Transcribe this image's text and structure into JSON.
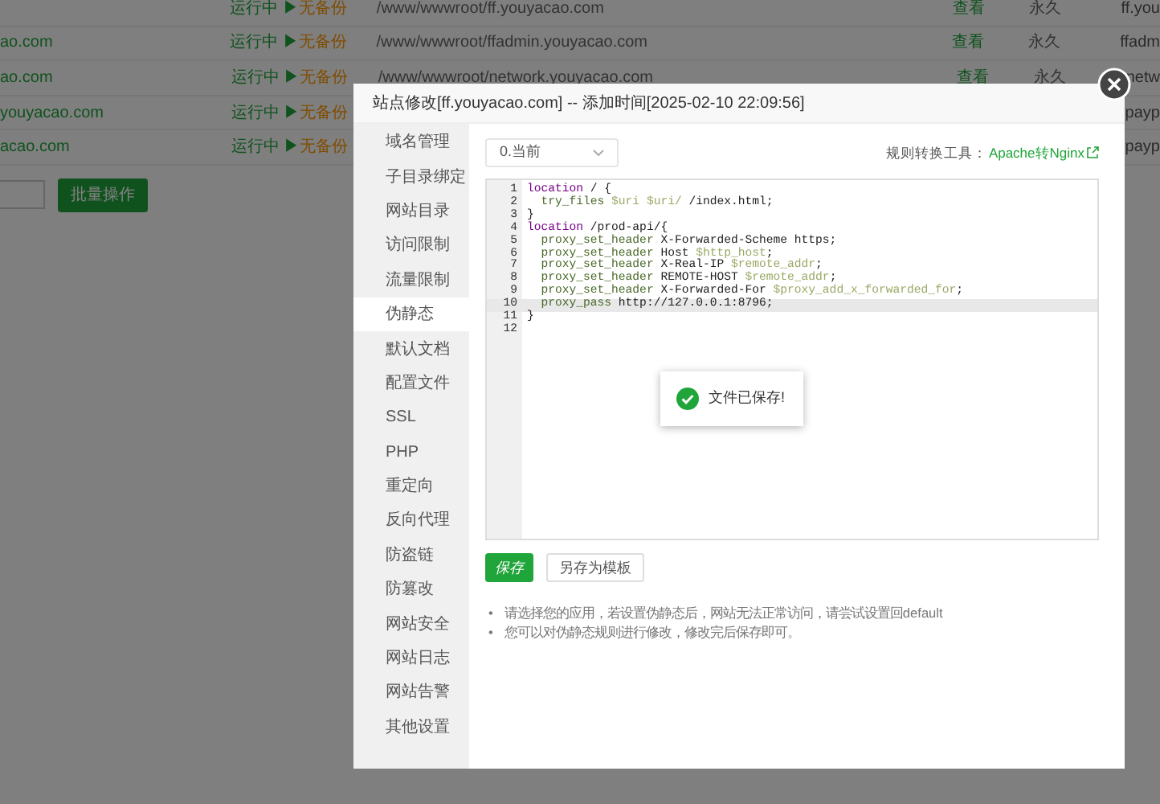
{
  "site_table": {
    "rows": [
      {
        "status": "运行中 ▶",
        "backup": "无备份",
        "path": "/www/wwwroot/ff.youyacao.com",
        "action": "查看",
        "expiry": "永久",
        "column_7": "ff.you"
      },
      {
        "name": "ao.com",
        "status": "运行中 ▶",
        "backup": "无备份",
        "path": "/www/wwwroot/ffadmin.youyacao.com",
        "action": "查看",
        "expiry": "永久",
        "column_7": "ffadm"
      },
      {
        "name": "ao.com",
        "status": "运行中 ▶",
        "backup": "无备份",
        "path": "/www/wwwroot/network.youyacao.com",
        "action": "查看",
        "expiry": "永久",
        "column_7": "netw"
      },
      {
        "name": "youyacao.com",
        "status": "运行中 ▶",
        "backup": "无备份",
        "column_7": "payp"
      },
      {
        "name": "acao.com",
        "status": "运行中 ▶",
        "backup": "无备份",
        "column_7": "payp"
      }
    ]
  },
  "batch_button": "批量操作",
  "modal": {
    "title": "站点修改[ff.youyacao.com] -- 添加时间[2025-02-10 22:09:56]",
    "sidebar": [
      {
        "label": "域名管理",
        "selected": false
      },
      {
        "label": "子目录绑定",
        "selected": false
      },
      {
        "label": "网站目录",
        "selected": false
      },
      {
        "label": "访问限制",
        "selected": false
      },
      {
        "label": "流量限制",
        "selected": false
      },
      {
        "label": "伪静态",
        "selected": true
      },
      {
        "label": "默认文档",
        "selected": false
      },
      {
        "label": "配置文件",
        "selected": false
      },
      {
        "label": "SSL",
        "selected": false
      },
      {
        "label": "PHP",
        "selected": false
      },
      {
        "label": "重定向",
        "selected": false
      },
      {
        "label": "反向代理",
        "selected": false
      },
      {
        "label": "防盗链",
        "selected": false
      },
      {
        "label": "防篡改",
        "selected": false
      },
      {
        "label": "网站安全",
        "selected": false
      },
      {
        "label": "网站日志",
        "selected": false
      },
      {
        "label": "网站告警",
        "selected": false
      },
      {
        "label": "其他设置",
        "selected": false
      }
    ],
    "version_select": "0.当前",
    "converter_label": "规则转换工具：",
    "converter_link": "Apache转Nginx",
    "editor": {
      "lines": [
        {
          "number": "1",
          "current": false,
          "tokens": [
            {
              "text": "location",
              "kind": "keyword"
            },
            {
              "text": " / {",
              "kind": "plain"
            }
          ]
        },
        {
          "number": "2",
          "current": false,
          "tokens": [
            {
              "text": "  try_files ",
              "kind": "directive"
            },
            {
              "text": "$uri $uri/",
              "kind": "variable"
            },
            {
              "text": " /index.html;",
              "kind": "plain"
            }
          ]
        },
        {
          "number": "3",
          "current": false,
          "tokens": [
            {
              "text": "}",
              "kind": "plain"
            }
          ]
        },
        {
          "number": "4",
          "current": false,
          "tokens": [
            {
              "text": "location",
              "kind": "keyword"
            },
            {
              "text": " /prod-api/{",
              "kind": "plain"
            }
          ]
        },
        {
          "number": "5",
          "current": false,
          "tokens": [
            {
              "text": "  proxy_set_header",
              "kind": "directive"
            },
            {
              "text": " X-Forwarded-Scheme https;",
              "kind": "plain"
            }
          ]
        },
        {
          "number": "6",
          "current": false,
          "tokens": [
            {
              "text": "  proxy_set_header",
              "kind": "directive"
            },
            {
              "text": " Host ",
              "kind": "plain"
            },
            {
              "text": "$http_host",
              "kind": "variable"
            },
            {
              "text": ";",
              "kind": "plain"
            }
          ]
        },
        {
          "number": "7",
          "current": false,
          "tokens": [
            {
              "text": "  proxy_set_header",
              "kind": "directive"
            },
            {
              "text": " X-Real-IP ",
              "kind": "plain"
            },
            {
              "text": "$remote_addr",
              "kind": "variable"
            },
            {
              "text": ";",
              "kind": "plain"
            }
          ]
        },
        {
          "number": "8",
          "current": false,
          "tokens": [
            {
              "text": "  proxy_set_header",
              "kind": "directive"
            },
            {
              "text": " REMOTE-HOST ",
              "kind": "plain"
            },
            {
              "text": "$remote_addr",
              "kind": "variable"
            },
            {
              "text": ";",
              "kind": "plain"
            }
          ]
        },
        {
          "number": "9",
          "current": false,
          "tokens": [
            {
              "text": "  proxy_set_header",
              "kind": "directive"
            },
            {
              "text": " X-Forwarded-For ",
              "kind": "plain"
            },
            {
              "text": "$proxy_add_x_forwarded_for",
              "kind": "variable"
            },
            {
              "text": ";",
              "kind": "plain"
            }
          ]
        },
        {
          "number": "10",
          "current": true,
          "tokens": [
            {
              "text": "  proxy_pass",
              "kind": "directive"
            },
            {
              "text": " http://127.0.0.1:8796;",
              "kind": "plain"
            }
          ]
        },
        {
          "number": "11",
          "current": false,
          "tokens": [
            {
              "text": "}",
              "kind": "plain"
            }
          ]
        },
        {
          "number": "12",
          "current": false
        }
      ]
    },
    "toast": "文件已保存!",
    "buttons": [
      {
        "label": "保存",
        "kind": "primary"
      },
      {
        "label": "另存为模板",
        "kind": "secondary"
      }
    ],
    "notes": [
      {
        "bullet": "•",
        "text": "请选择您的应用，若设置伪静态后，网站无法正常访问，请尝试设置回default"
      },
      {
        "bullet": "•",
        "text": "您可以对伪静态规则进行修改，修改完后保存即可。"
      }
    ]
  }
}
